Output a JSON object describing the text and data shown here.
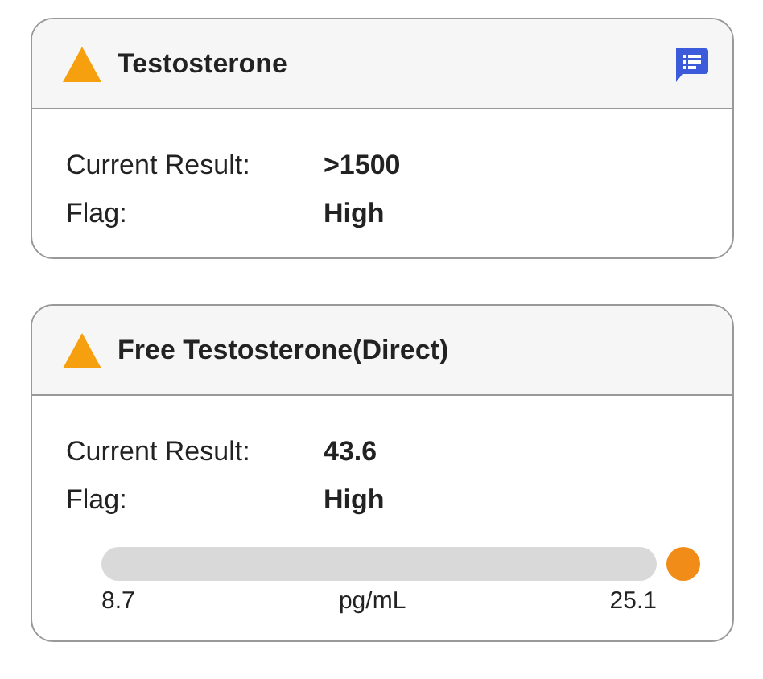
{
  "results": [
    {
      "title": "Testosterone",
      "abnormal": true,
      "has_comment": true,
      "rows": [
        {
          "label": "Current Result:",
          "value": ">1500"
        },
        {
          "label": "Flag:",
          "value": "High"
        }
      ]
    },
    {
      "title": "Free Testosterone(Direct)",
      "abnormal": true,
      "has_comment": false,
      "rows": [
        {
          "label": "Current Result:",
          "value": "43.6"
        },
        {
          "label": "Flag:",
          "value": "High"
        }
      ],
      "range": {
        "low": "8.7",
        "unit": "pg/mL",
        "high": "25.1",
        "above_range": true
      }
    }
  ]
}
